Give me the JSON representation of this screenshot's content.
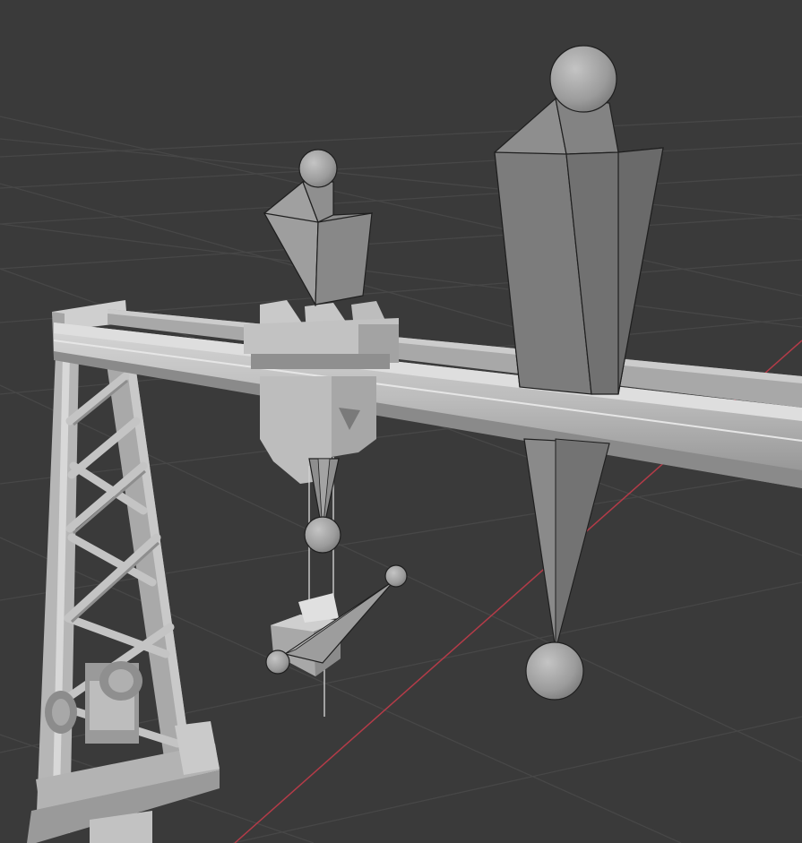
{
  "viewport": {
    "background_color": "#3a3a3a",
    "grid_color": "#474747",
    "x_axis_color": "#b43b48",
    "object_base_color": "#bdbdbd",
    "bone_color": "#9a9a9a",
    "joint_color": "#a8a8a8"
  },
  "scene": {
    "objects": [
      {
        "name": "gantry-crane",
        "icon": "crane-mesh"
      },
      {
        "name": "armature-bone-upper-left",
        "icon": "bone-octahedral"
      },
      {
        "name": "armature-bone-lower-left",
        "icon": "bone-octahedral"
      },
      {
        "name": "armature-bone-hook",
        "icon": "bone-octahedral"
      },
      {
        "name": "armature-bone-right",
        "icon": "bone-octahedral"
      }
    ]
  }
}
